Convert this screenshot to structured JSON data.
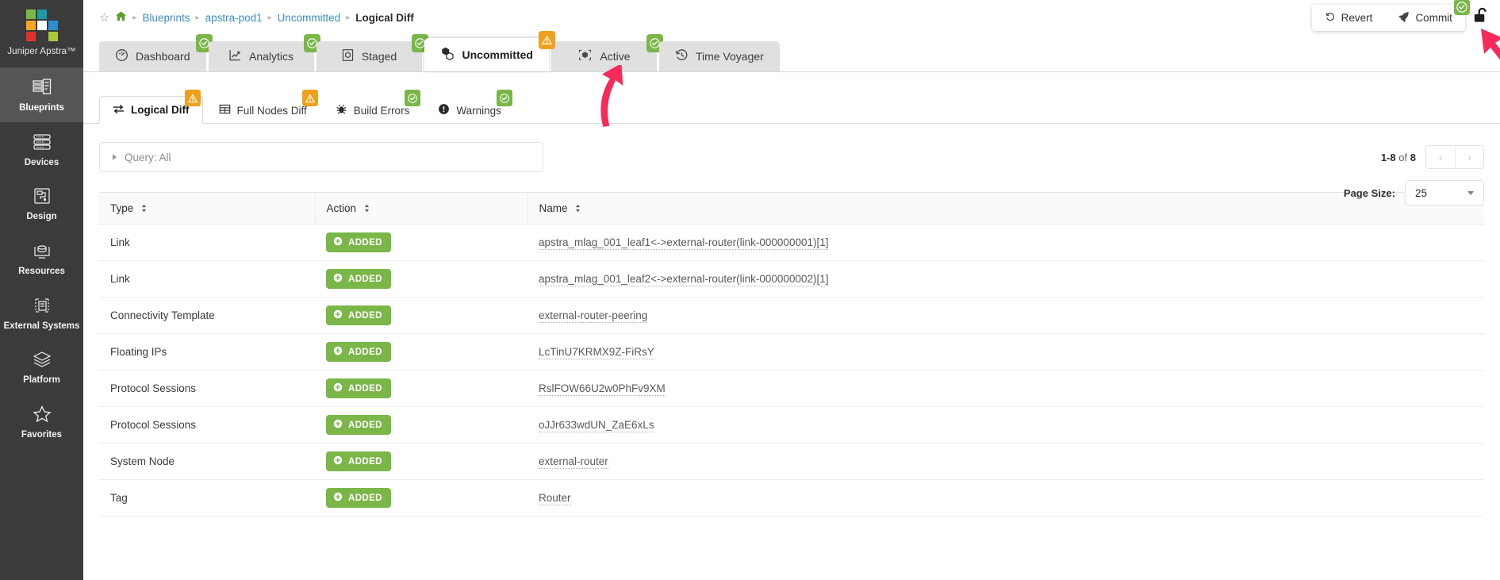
{
  "sidebar": {
    "brand": "Juniper Apstra™",
    "items": [
      {
        "label": "Blueprints",
        "icon": "blueprints-icon",
        "active": true
      },
      {
        "label": "Devices",
        "icon": "devices-icon",
        "active": false
      },
      {
        "label": "Design",
        "icon": "design-icon",
        "active": false
      },
      {
        "label": "Resources",
        "icon": "resources-icon",
        "active": false
      },
      {
        "label": "External Systems",
        "icon": "external-systems-icon",
        "active": false
      },
      {
        "label": "Platform",
        "icon": "platform-icon",
        "active": false
      },
      {
        "label": "Favorites",
        "icon": "favorites-star-icon",
        "active": false
      }
    ]
  },
  "breadcrumb": {
    "star": "☆",
    "home": "⌂",
    "items": [
      {
        "label": "Blueprints",
        "current": false
      },
      {
        "label": "apstra-pod1",
        "current": false
      },
      {
        "label": "Uncommitted",
        "current": false
      },
      {
        "label": "Logical Diff",
        "current": true
      }
    ]
  },
  "actions": {
    "revert_label": "Revert",
    "commit_label": "Commit",
    "commit_badge": "check",
    "lock_icon": "unlocked-padlock-icon"
  },
  "tabs": [
    {
      "label": "Dashboard",
      "icon": "dashboard-gauge-icon",
      "badge": "ok",
      "active": false
    },
    {
      "label": "Analytics",
      "icon": "analytics-chart-icon",
      "badge": "ok",
      "active": false
    },
    {
      "label": "Staged",
      "icon": "staged-box-icon",
      "badge": "ok",
      "active": false
    },
    {
      "label": "Uncommitted",
      "icon": "uncommitted-boxes-icon",
      "badge": "warn",
      "active": true
    },
    {
      "label": "Active",
      "icon": "active-cube-icon",
      "badge": "ok",
      "active": false
    },
    {
      "label": "Time Voyager",
      "icon": "clock-rewind-icon",
      "badge": "none",
      "active": false
    }
  ],
  "subtabs": [
    {
      "label": "Logical Diff",
      "icon": "exchange-arrows-icon",
      "badge": "warn",
      "active": true
    },
    {
      "label": "Full Nodes Diff",
      "icon": "table-grid-icon",
      "badge": "warn",
      "active": false
    },
    {
      "label": "Build Errors",
      "icon": "bug-icon",
      "badge": "ok",
      "active": false
    },
    {
      "label": "Warnings",
      "icon": "exclamation-circle-icon",
      "badge": "ok",
      "active": false
    }
  ],
  "query": {
    "label": "Query: All"
  },
  "paging": {
    "range": "1-8",
    "of_text": " of ",
    "total": "8",
    "prev": "‹",
    "next": "›",
    "page_size_label": "Page Size:",
    "page_size_value": "25"
  },
  "table": {
    "columns": [
      {
        "label": "Type",
        "sortable": true
      },
      {
        "label": "Action",
        "sortable": true
      },
      {
        "label": "Name",
        "sortable": true
      }
    ],
    "rows": [
      {
        "type": "Link",
        "action": "ADDED",
        "name": "apstra_mlag_001_leaf1<->external-router(link-000000001)[1]"
      },
      {
        "type": "Link",
        "action": "ADDED",
        "name": "apstra_mlag_001_leaf2<->external-router(link-000000002)[1]"
      },
      {
        "type": "Connectivity Template",
        "action": "ADDED",
        "name": "external-router-peering"
      },
      {
        "type": "Floating IPs",
        "action": "ADDED",
        "name": "LcTinU7KRMX9Z-FiRsY"
      },
      {
        "type": "Protocol Sessions",
        "action": "ADDED",
        "name": "RslFOW66U2w0PhFv9XM"
      },
      {
        "type": "Protocol Sessions",
        "action": "ADDED",
        "name": "oJJr633wdUN_ZaE6xLs"
      },
      {
        "type": "System Node",
        "action": "ADDED",
        "name": "external-router"
      },
      {
        "type": "Tag",
        "action": "ADDED",
        "name": "Router"
      }
    ]
  },
  "colors": {
    "sidebar_bg": "#3b3b3b",
    "sidebar_active": "#555555",
    "green": "#7ab648",
    "amber": "#f0a01e",
    "link_blue": "#3a8fc4",
    "annotation_pink": "#f72a5a"
  },
  "annotations": {
    "arrow_1_target": "Uncommitted tab",
    "arrow_2_target": "Commit button"
  }
}
